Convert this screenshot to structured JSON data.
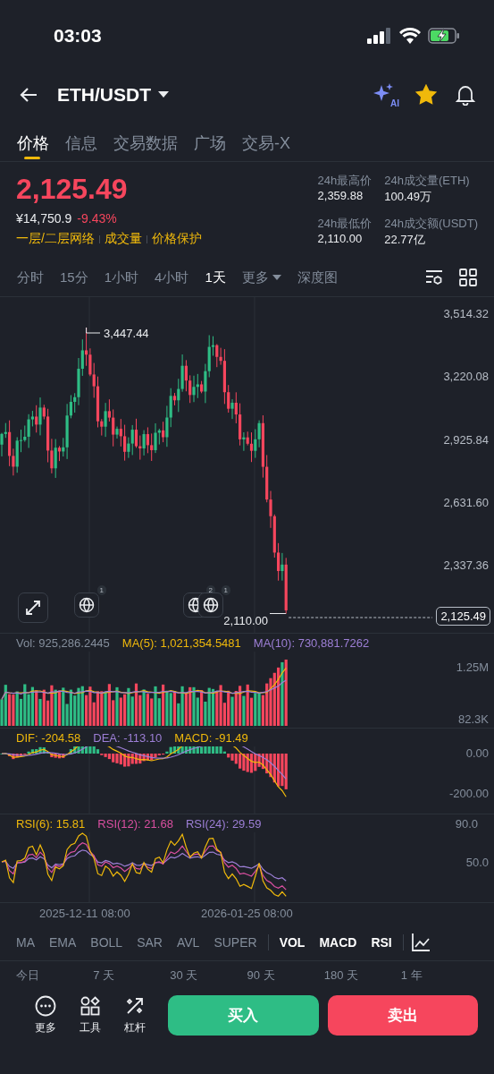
{
  "status_bar": {
    "time": "03:03"
  },
  "header": {
    "title": "ETH/USDT",
    "ai_badge": "AI",
    "favorited": true
  },
  "tabs": [
    {
      "label": "价格",
      "selected": true
    },
    {
      "label": "信息",
      "selected": false
    },
    {
      "label": "交易数据",
      "selected": false
    },
    {
      "label": "广场",
      "selected": false
    },
    {
      "label": "交易-X",
      "selected": false
    }
  ],
  "price": {
    "last": "2,125.49",
    "fiat": "¥14,750.9",
    "change": "-9.43%",
    "tags": [
      "一层/二层网络",
      "成交量",
      "价格保护"
    ]
  },
  "stats": [
    {
      "label": "24h最高价",
      "value": "2,359.88"
    },
    {
      "label": "24h成交量(ETH)",
      "value": "100.49万"
    },
    {
      "label": "24h最低价",
      "value": "2,110.00"
    },
    {
      "label": "24h成交额(USDT)",
      "value": "22.77亿"
    }
  ],
  "intervals": [
    {
      "label": "分时",
      "selected": false,
      "kind": "option"
    },
    {
      "label": "15分",
      "selected": false,
      "kind": "option"
    },
    {
      "label": "1小时",
      "selected": false,
      "kind": "option"
    },
    {
      "label": "4小时",
      "selected": false,
      "kind": "option"
    },
    {
      "label": "1天",
      "selected": true,
      "kind": "option"
    },
    {
      "label": "更多",
      "selected": false,
      "kind": "menu"
    },
    {
      "label": "深度图",
      "selected": false,
      "kind": "option"
    }
  ],
  "chart": {
    "price_axis": [
      "3,514.32",
      "3,220.08",
      "2,925.84",
      "2,631.60",
      "2,337.36"
    ],
    "high_label": "3,447.44",
    "low_label": "2,110.00",
    "last_price": "2,125.49",
    "markers": [
      {
        "badge": "1"
      },
      {
        "badge": "2"
      },
      {
        "badge": "1"
      }
    ]
  },
  "volume": {
    "legend": [
      {
        "label": "Vol: 925,286.2445",
        "color": "#848e9c"
      },
      {
        "label": "MA(5): 1,021,354.5481",
        "color": "#f0b90b"
      },
      {
        "label": "MA(10): 730,881.7262",
        "color": "#9d7fd6"
      }
    ],
    "axis": [
      "1.25M",
      "82.3K"
    ]
  },
  "macd": {
    "legend": [
      {
        "label": "DIF: -204.58",
        "color": "#f0b90b"
      },
      {
        "label": "DEA: -113.10",
        "color": "#9d7fd6"
      },
      {
        "label": "MACD: -91.49",
        "color": "#f0b90b"
      }
    ],
    "axis": [
      "0.00",
      "-200.00"
    ]
  },
  "rsi": {
    "legend": [
      {
        "label": "RSI(6): 15.81",
        "color": "#f0b90b"
      },
      {
        "label": "RSI(12): 21.68",
        "color": "#d94fa0"
      },
      {
        "label": "RSI(24): 29.59",
        "color": "#9d7fd6"
      }
    ],
    "axis": [
      "90.0",
      "50.0"
    ]
  },
  "dates": [
    "2025-12-11 08:00",
    "2026-01-25 08:00"
  ],
  "indicators": {
    "main": [
      {
        "label": "MA",
        "selected": false
      },
      {
        "label": "EMA",
        "selected": false
      },
      {
        "label": "BOLL",
        "selected": false
      },
      {
        "label": "SAR",
        "selected": false
      },
      {
        "label": "AVL",
        "selected": false
      },
      {
        "label": "SUPER",
        "selected": false
      }
    ],
    "sub": [
      {
        "label": "VOL",
        "selected": true
      },
      {
        "label": "MACD",
        "selected": true
      },
      {
        "label": "RSI",
        "selected": true
      }
    ]
  },
  "ranges": [
    "今日",
    "7 天",
    "30 天",
    "90 天",
    "180 天",
    "1 年"
  ],
  "actions": [
    {
      "label": "更多",
      "kind": "more"
    },
    {
      "label": "工具",
      "kind": "tools"
    },
    {
      "label": "杠杆",
      "kind": "leverage"
    }
  ],
  "trade": [
    {
      "label": "买入",
      "kind": "buy"
    },
    {
      "label": "卖出",
      "kind": "sell"
    }
  ]
}
